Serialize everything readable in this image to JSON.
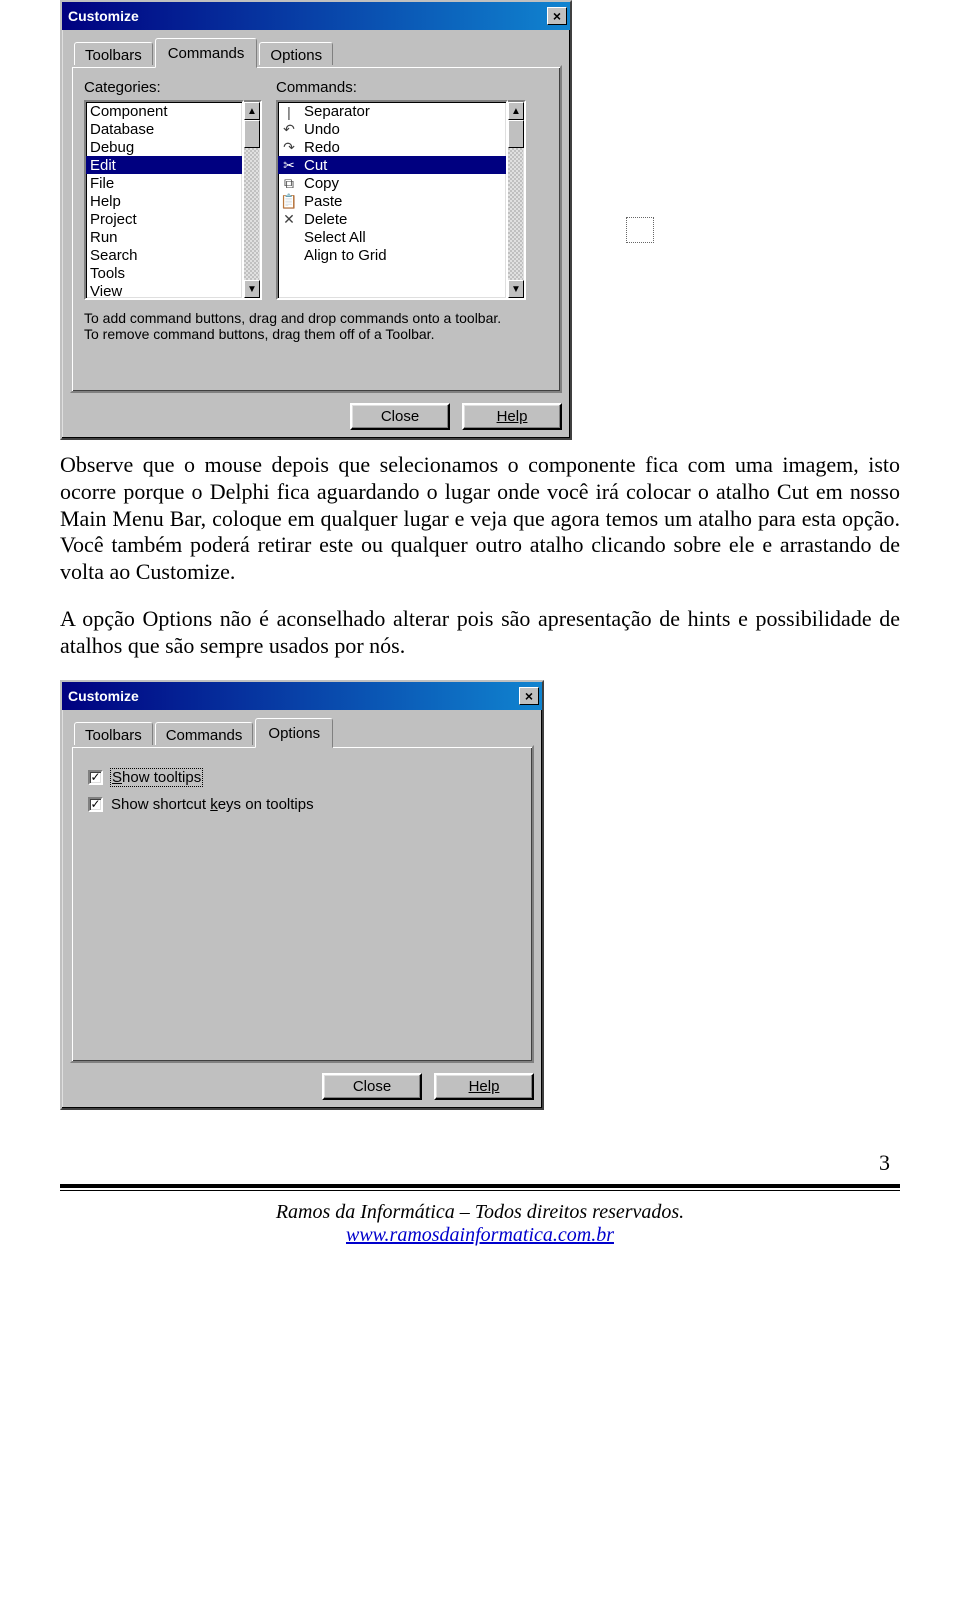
{
  "dialog1": {
    "title": "Customize",
    "tabs": {
      "toolbars": "Toolbars",
      "commands": "Commands",
      "options": "Options"
    },
    "labels": {
      "categories": "Categories:",
      "commands": "Commands:"
    },
    "categories": [
      "Component",
      "Database",
      "Debug",
      "Edit",
      "File",
      "Help",
      "Project",
      "Run",
      "Search",
      "Tools",
      "View"
    ],
    "selected_category_index": 3,
    "commands": [
      {
        "glyph": "|",
        "label": "Separator"
      },
      {
        "glyph": "↶",
        "label": "Undo"
      },
      {
        "glyph": "↷",
        "label": "Redo"
      },
      {
        "glyph": "✂",
        "label": "Cut"
      },
      {
        "glyph": "⧉",
        "label": "Copy"
      },
      {
        "glyph": "📋",
        "label": "Paste"
      },
      {
        "glyph": "✕",
        "label": "Delete"
      },
      {
        "glyph": "",
        "label": "Select All"
      },
      {
        "glyph": "",
        "label": "Align to Grid"
      }
    ],
    "selected_command_index": 3,
    "instruction1": "To add command buttons, drag and drop commands onto a toolbar.",
    "instruction2": "To remove command buttons, drag them off of a Toolbar.",
    "close": "Close",
    "help": "Help"
  },
  "para1": "Observe que o mouse depois que selecionamos o componente fica com uma imagem, isto ocorre porque o Delphi fica aguardando o lugar onde você irá colocar o atalho Cut em nosso Main Menu Bar, coloque em qualquer lugar e veja que agora temos um atalho para esta opção. Você também poderá retirar este ou qualquer outro atalho clicando sobre ele e arrastando de volta ao Customize.",
  "para2": "A opção Options não é aconselhado alterar pois são apresentação de hints e possibilidade de atalhos que são sempre usados por nós.",
  "dialog2": {
    "title": "Customize",
    "tabs": {
      "toolbars": "Toolbars",
      "commands": "Commands",
      "options": "Options"
    },
    "opt1_prefix": "S",
    "opt1_rest": "how tooltips",
    "opt2_pre": "Show shortcut ",
    "opt2_u": "k",
    "opt2_post": "eys on tooltips",
    "close": "Close",
    "help": "Help"
  },
  "footer": {
    "pagenum": "3",
    "line": "Ramos da Informática – Todos direitos reservados.",
    "url": "www.ramosdainformatica.com.br"
  }
}
